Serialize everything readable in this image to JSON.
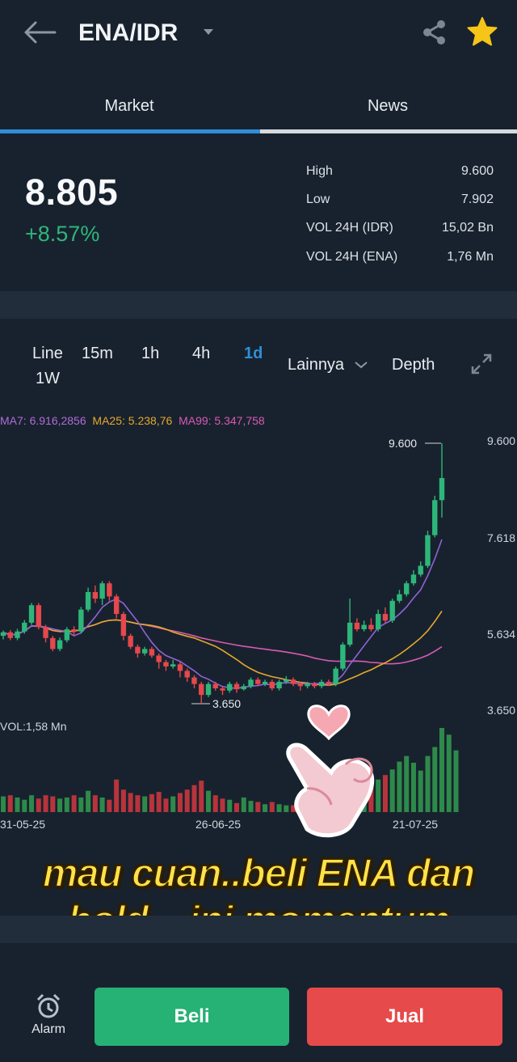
{
  "header": {
    "pair": "ENA/IDR"
  },
  "tabs": [
    {
      "label": "Market",
      "active": true
    },
    {
      "label": "News",
      "active": false
    }
  ],
  "ticker": {
    "price": "8.805",
    "change": "+8.57%",
    "change_color": "#2eb67a",
    "stats": [
      {
        "label": "High",
        "value": "9.600"
      },
      {
        "label": "Low",
        "value": "7.902"
      },
      {
        "label": "VOL 24H (IDR)",
        "value": "15,02 Bn"
      },
      {
        "label": "VOL 24H (ENA)",
        "value": "1,76 Mn"
      }
    ]
  },
  "chart_controls": {
    "intervals": [
      "Line",
      "15m",
      "1h",
      "4h",
      "1d",
      "1W"
    ],
    "active_interval": "1d",
    "more_label": "Lainnya",
    "depth_label": "Depth"
  },
  "ma_legend": {
    "ma7": "MA7: 6.916,2856",
    "ma25": "MA25: 5.238,76",
    "ma99": "MA99: 5.347,758"
  },
  "chart_data": {
    "type": "candlestick",
    "y_ticks": [
      "9.600",
      "7.618",
      "5.634",
      "3.650"
    ],
    "x_ticks": [
      "31-05-25",
      "26-06-25",
      "21-07-25"
    ],
    "price_range": [
      3650,
      9600
    ],
    "annotations": {
      "high": "9.600",
      "low": "3.650"
    },
    "volume_label": "VOL:1,58 Mn",
    "colors": {
      "up": "#2eb67a",
      "down": "#e5484d",
      "ma7": "#8f63d9",
      "ma25": "#e5a82c",
      "ma99": "#d85ab4"
    },
    "candles": [
      [
        5200,
        5280,
        5120,
        5320
      ],
      [
        5280,
        5150,
        5100,
        5330
      ],
      [
        5150,
        5300,
        5100,
        5360
      ],
      [
        5300,
        5500,
        5250,
        5560
      ],
      [
        5500,
        5900,
        5450,
        5950
      ],
      [
        5900,
        5400,
        5350,
        5950
      ],
      [
        5400,
        5150,
        5050,
        5450
      ],
      [
        5150,
        4900,
        4850,
        5200
      ],
      [
        4900,
        5100,
        4850,
        5160
      ],
      [
        5100,
        5350,
        5050,
        5400
      ],
      [
        5350,
        5300,
        5200,
        5420
      ],
      [
        5300,
        5800,
        5250,
        5860
      ],
      [
        5800,
        6200,
        5750,
        6300
      ],
      [
        6200,
        6050,
        5950,
        6350
      ],
      [
        6050,
        6400,
        5900,
        6450
      ],
      [
        6400,
        6100,
        6000,
        6450
      ],
      [
        6100,
        5700,
        5600,
        6150
      ],
      [
        5700,
        5200,
        5100,
        5750
      ],
      [
        5200,
        4950,
        4900,
        5250
      ],
      [
        4950,
        4800,
        4700,
        5000
      ],
      [
        4800,
        4900,
        4750,
        4950
      ],
      [
        4900,
        4750,
        4700,
        4950
      ],
      [
        4750,
        4600,
        4450,
        4800
      ],
      [
        4600,
        4500,
        4400,
        4650
      ],
      [
        4500,
        4550,
        4450,
        4650
      ],
      [
        4550,
        4400,
        4250,
        4600
      ],
      [
        4400,
        4250,
        4150,
        4450
      ],
      [
        4250,
        4100,
        4000,
        4300
      ],
      [
        4100,
        3850,
        3650,
        4150
      ],
      [
        3850,
        4100,
        3800,
        4150
      ],
      [
        4100,
        4000,
        3950,
        4150
      ],
      [
        4000,
        3950,
        3850,
        4050
      ],
      [
        3950,
        4100,
        3900,
        4150
      ],
      [
        4100,
        3980,
        3900,
        4150
      ],
      [
        3980,
        4050,
        3950,
        4100
      ],
      [
        4050,
        4200,
        4000,
        4250
      ],
      [
        4200,
        4100,
        4050,
        4250
      ],
      [
        4100,
        4150,
        4050,
        4200
      ],
      [
        4150,
        4000,
        3950,
        4200
      ],
      [
        4000,
        4150,
        3950,
        4200
      ],
      [
        4150,
        4200,
        4100,
        4280
      ],
      [
        4200,
        4100,
        4050,
        4250
      ],
      [
        4100,
        4050,
        3950,
        4150
      ],
      [
        4050,
        4100,
        4000,
        4150
      ],
      [
        4100,
        4050,
        4000,
        4150
      ],
      [
        4050,
        4150,
        4000,
        4200
      ],
      [
        4150,
        4100,
        4050,
        4200
      ],
      [
        4100,
        4450,
        4050,
        4500
      ],
      [
        4450,
        5000,
        4400,
        5050
      ],
      [
        5000,
        5500,
        4950,
        6050
      ],
      [
        5500,
        5350,
        5300,
        5600
      ],
      [
        5350,
        5450,
        5300,
        5550
      ],
      [
        5450,
        5350,
        5300,
        5600
      ],
      [
        5350,
        5700,
        5300,
        5800
      ],
      [
        5700,
        5550,
        5500,
        5850
      ],
      [
        5550,
        6000,
        5500,
        6050
      ],
      [
        6000,
        6150,
        5950,
        6250
      ],
      [
        6150,
        6400,
        6100,
        6450
      ],
      [
        6400,
        6600,
        6350,
        6700
      ],
      [
        6600,
        6800,
        6550,
        6900
      ],
      [
        6800,
        7500,
        6750,
        7600
      ],
      [
        7500,
        8300,
        7450,
        8400
      ],
      [
        8300,
        8805,
        7902,
        9600
      ]
    ],
    "volume": [
      28,
      30,
      26,
      22,
      30,
      24,
      30,
      28,
      24,
      26,
      30,
      26,
      38,
      30,
      26,
      22,
      58,
      40,
      34,
      30,
      28,
      32,
      36,
      24,
      28,
      34,
      40,
      48,
      56,
      38,
      30,
      24,
      22,
      16,
      26,
      20,
      18,
      14,
      18,
      14,
      12,
      12,
      12,
      12,
      10,
      12,
      14,
      16,
      20,
      30,
      36,
      40,
      44,
      58,
      66,
      76,
      90,
      100,
      88,
      74,
      100,
      116,
      150,
      138,
      110
    ]
  },
  "overlay": {
    "line1": "mau cuan..beli ENA dan",
    "line2": "hold... ini momentum"
  },
  "bottom": {
    "alarm_label": "Alarm",
    "buy_label": "Beli",
    "sell_label": "Jual",
    "buy_color": "#26b175",
    "sell_color": "#e64a4a"
  }
}
